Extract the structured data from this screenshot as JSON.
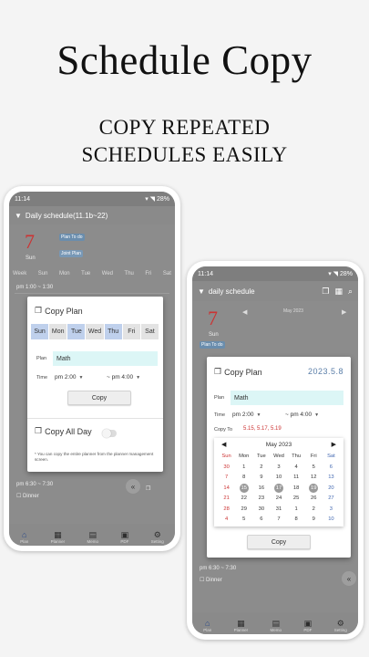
{
  "headline": {
    "title": "Schedule Copy",
    "line1": "COPY REPEATED",
    "line2": "SCHEDULES EASILY"
  },
  "colors": {
    "accent": "#5a7ea8",
    "sunday": "#cc3333",
    "saturday": "#4066b0",
    "plan_field": "#dcf6f6",
    "day_selected": "#bfd0ec"
  },
  "phone1": {
    "status_time": "11:14",
    "status_right": "28%",
    "header_title": "Daily schedule(11.1b~22)",
    "date_number": "7",
    "date_day": "Sun",
    "tag1": "Plan To do",
    "tag2": "Joint Plan",
    "weekdays": [
      "Week",
      "Sun",
      "Mon",
      "Tue",
      "Wed",
      "Thu",
      "Fri",
      "Sat"
    ],
    "time_row": "pm 1:00 ~ 1:30",
    "bottom_time": "pm 6:30 ~ 7:30",
    "bottom_item": "Dinner",
    "dialog": {
      "title": "Copy Plan",
      "days": [
        "Sun",
        "Mon",
        "Tue",
        "Wed",
        "Thu",
        "Fri",
        "Sat"
      ],
      "selected_days": [
        0,
        2,
        4
      ],
      "plan_label": "Plan",
      "plan_value": "Math",
      "time_label": "Time",
      "time_start": "pm 2:00",
      "time_end": "~ pm 4:00",
      "copy_button": "Copy",
      "copy_all_day": "Copy All Day",
      "note": "* You can copy the entire planner from the planner management screen."
    },
    "nav": [
      "Plan",
      "Planner",
      "Memo",
      "PDF",
      "Setting"
    ]
  },
  "phone2": {
    "status_time": "11:14",
    "status_right": "28%",
    "header_title": "daily schedule",
    "date_number": "7",
    "date_day": "Sun",
    "tag1": "Plan To do",
    "bg_month": "May 2023",
    "bottom_time": "pm 6:30 ~ 7:30",
    "bottom_item": "Dinner",
    "dialog": {
      "title": "Copy Plan",
      "date": "2023.5.8",
      "plan_label": "Plan",
      "plan_value": "Math",
      "time_label": "Time",
      "time_start": "pm 2:00",
      "time_end": "~ pm 4:00",
      "copy_to_label": "Copy To",
      "copy_to_value": "5.15, 5.17, 5.19",
      "calendar": {
        "month": "May 2023",
        "weekdays": [
          "Sun",
          "Mon",
          "Tue",
          "Wed",
          "Thu",
          "Fri",
          "Sat"
        ],
        "days": [
          "30",
          "1",
          "2",
          "3",
          "4",
          "5",
          "6",
          "7",
          "8",
          "9",
          "10",
          "11",
          "12",
          "13",
          "14",
          "15",
          "16",
          "17",
          "18",
          "19",
          "20",
          "21",
          "22",
          "23",
          "24",
          "25",
          "26",
          "27",
          "28",
          "29",
          "30",
          "31",
          "1",
          "2",
          "3",
          "4",
          "5",
          "6",
          "7",
          "8",
          "9",
          "10"
        ],
        "marked": [
          "15",
          "17",
          "19"
        ]
      },
      "copy_button": "Copy"
    },
    "nav": [
      "Plan",
      "Planner",
      "Memo",
      "PDF",
      "Setting"
    ]
  }
}
